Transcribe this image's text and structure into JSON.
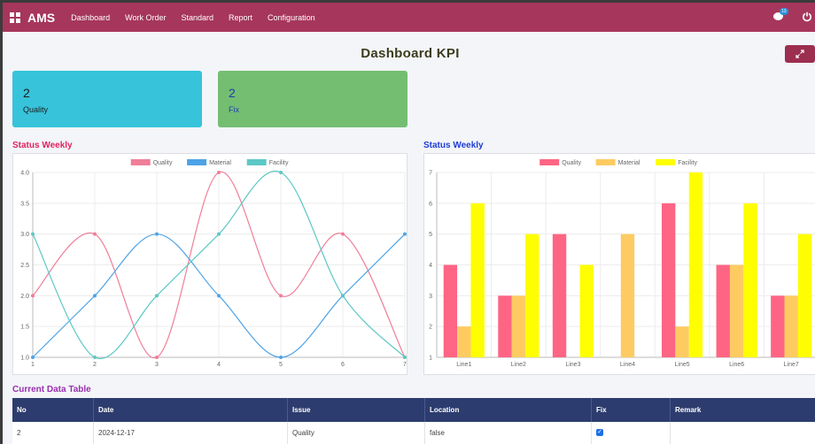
{
  "app": {
    "brand": "AMS",
    "nav": [
      "Dashboard",
      "Work Order",
      "Standard",
      "Report",
      "Configuration"
    ],
    "notification_count": "13"
  },
  "page": {
    "title": "Dashboard KPI",
    "expand_icon": "expand-icon"
  },
  "kpis": [
    {
      "value": "2",
      "label": "Quality",
      "color": "#37c3da"
    },
    {
      "value": "2",
      "label": "Fix",
      "color": "#74be72"
    }
  ],
  "line_section_title": "Status Weekly",
  "bar_section_title": "Status Weekly",
  "chart_data": [
    {
      "type": "line",
      "title": "Status Weekly",
      "x": [
        1,
        2,
        3,
        4,
        5,
        6,
        7
      ],
      "ylim": [
        1.0,
        4.0
      ],
      "yticks": [
        "1.0",
        "1.5",
        "2.0",
        "2.5",
        "3.0",
        "3.5",
        "4.0"
      ],
      "xticks": [
        "1",
        "2",
        "3",
        "4",
        "5",
        "6",
        "7"
      ],
      "legend_position": "top",
      "grid": true,
      "series": [
        {
          "name": "Quality",
          "color": "#f07e98",
          "values": [
            2,
            3,
            1,
            4,
            2,
            3,
            1
          ]
        },
        {
          "name": "Material",
          "color": "#4ea3e6",
          "values": [
            1,
            2,
            3,
            2,
            1,
            2,
            3
          ]
        },
        {
          "name": "Facility",
          "color": "#5cc8c4",
          "values": [
            3,
            1,
            2,
            3,
            4,
            2,
            1
          ]
        }
      ]
    },
    {
      "type": "bar",
      "title": "Status Weekly",
      "categories": [
        "Line1",
        "Line2",
        "Line3",
        "Line4",
        "Line5",
        "Line6",
        "Line7"
      ],
      "ylim": [
        1,
        7
      ],
      "yticks": [
        "1",
        "2",
        "3",
        "4",
        "5",
        "6",
        "7"
      ],
      "legend_position": "top",
      "grid": true,
      "series": [
        {
          "name": "Quality",
          "color": "#fe6584",
          "values": [
            4,
            3,
            5,
            1,
            6,
            4,
            3
          ]
        },
        {
          "name": "Material",
          "color": "#fecb62",
          "values": [
            2,
            3,
            1,
            5,
            2,
            4,
            3
          ]
        },
        {
          "name": "Facility",
          "color": "#fefe00",
          "values": [
            6,
            5,
            4,
            1,
            7,
            6,
            5
          ]
        }
      ]
    }
  ],
  "table": {
    "title": "Current Data Table",
    "columns": [
      "No",
      "Date",
      "Issue",
      "Location",
      "Fix",
      "Remark"
    ],
    "rows": [
      {
        "no": "2",
        "date": "2024-12-17",
        "issue": "Quality",
        "location": "false",
        "fix": true,
        "remark": ""
      }
    ]
  }
}
